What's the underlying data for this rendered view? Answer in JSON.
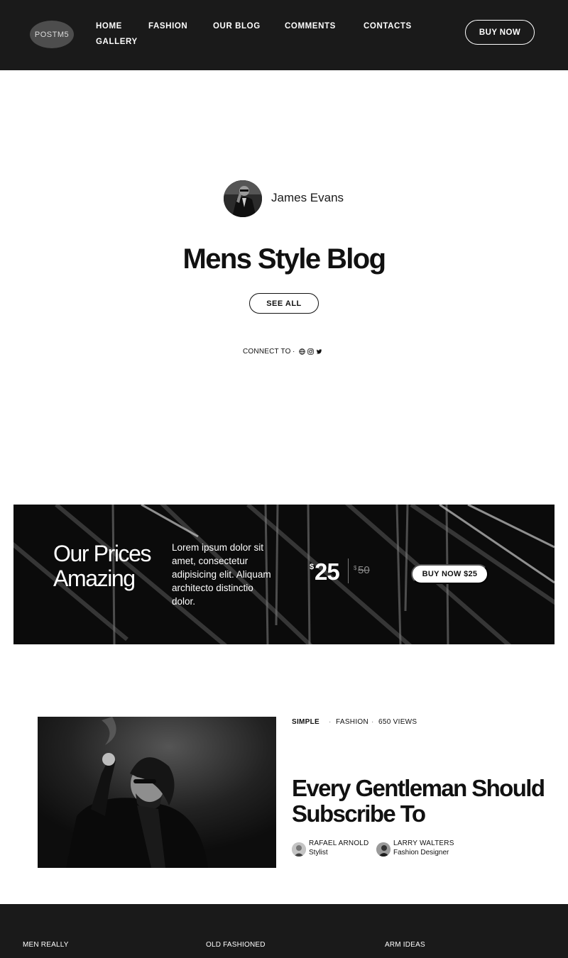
{
  "header": {
    "logo": "POSTM5",
    "nav": [
      "HOME",
      "FASHION",
      "OUR BLOG",
      "COMMENTS",
      "CONTACTS",
      "GALLERY"
    ],
    "buy_label": "BUY NOW"
  },
  "hero": {
    "author": "James Evans",
    "title": "Mens Style Blog",
    "see_all": "SEE ALL",
    "connect": "CONNECT TO",
    "separator": "·",
    "social_icons": [
      "globe-icon",
      "instagram-icon",
      "twitter-icon"
    ]
  },
  "promo": {
    "title_line1": "Our Prices",
    "title_line2": "Amazing",
    "text": "Lorem ipsum dolor sit amet, consectetur adipisicing elit. Aliquam architecto distinctio dolor.",
    "currency": "$",
    "price": "25",
    "old_price": "50",
    "button": "BUY NOW $25"
  },
  "article": {
    "category1": "SIMPLE",
    "category2": "FASHION",
    "views": "650 VIEWS",
    "separator": "·",
    "title": "Every Gentleman Should Subscribe To",
    "people": [
      {
        "name": "RAFAEL ARNOLD",
        "role": "Stylist"
      },
      {
        "name": "LARRY WALTERS",
        "role": "Fashion Designer"
      }
    ]
  },
  "footer": {
    "items": [
      "MEN REALLY",
      "OLD FASHIONED",
      "ARM IDEAS"
    ]
  },
  "colors": {
    "dark": "#1a1a1a",
    "text": "#111111",
    "muted": "#8a8a8a"
  }
}
